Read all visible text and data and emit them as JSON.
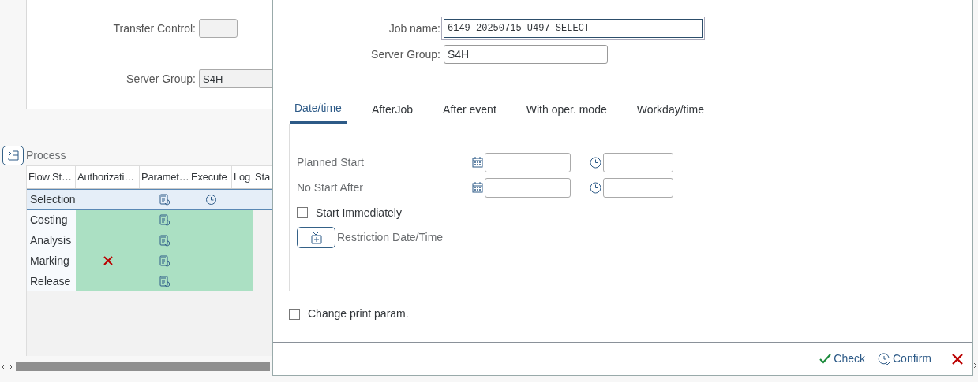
{
  "background": {
    "transfer_control": {
      "label": "Transfer Control:"
    },
    "server_group": {
      "label": "Server Group:",
      "value": "S4H"
    },
    "process": {
      "title": "Process",
      "columns": [
        "Flow St…",
        "Authorizati…",
        "Paramet…",
        "Execute",
        "Log",
        "Sta"
      ],
      "rows": [
        {
          "step": "Selection",
          "selected": true,
          "completed": false,
          "authorization_failed": false,
          "scheduled": true
        },
        {
          "step": "Costing",
          "selected": false,
          "completed": true,
          "authorization_failed": false,
          "scheduled": false
        },
        {
          "step": "Analysis",
          "selected": false,
          "completed": true,
          "authorization_failed": false,
          "scheduled": false
        },
        {
          "step": "Marking",
          "selected": false,
          "completed": true,
          "authorization_failed": true,
          "scheduled": false
        },
        {
          "step": "Release",
          "selected": false,
          "completed": true,
          "authorization_failed": false,
          "scheduled": false
        }
      ]
    }
  },
  "dialog": {
    "job_name": {
      "label": "Job name:",
      "value": "6149_20250715_U497_SELECT"
    },
    "server_group": {
      "label": "Server Group:",
      "value": "S4H"
    },
    "tabs": [
      {
        "label": "Date/time",
        "selected": true
      },
      {
        "label": "AfterJob",
        "selected": false
      },
      {
        "label": "After event",
        "selected": false
      },
      {
        "label": "With oper. mode",
        "selected": false
      },
      {
        "label": "Workday/time",
        "selected": false
      }
    ],
    "date_rows": [
      {
        "label": "Planned Start"
      },
      {
        "label": "No Start After"
      }
    ],
    "start_immediately": {
      "label": "Start Immediately",
      "checked": false
    },
    "restriction": {
      "label": "Restriction Date/Time"
    },
    "change_print_param": {
      "label": "Change print param.",
      "checked": false
    },
    "footer": {
      "buttons": [
        {
          "kind": "check",
          "label": "Check"
        },
        {
          "kind": "confirm",
          "label": "Confirm"
        },
        {
          "kind": "cancel"
        }
      ]
    }
  }
}
